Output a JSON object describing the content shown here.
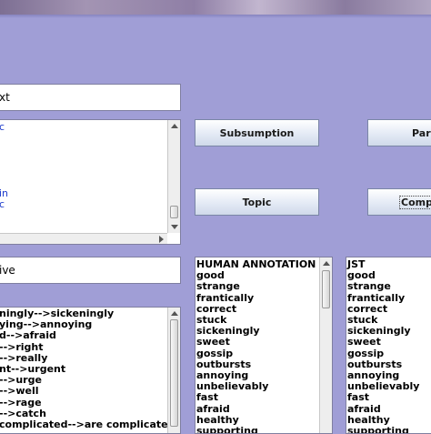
{
  "fields": {
    "top_text": "xt",
    "mid_text": "ive"
  },
  "upper_list": {
    "items": [
      "c",
      "",
      "",
      "",
      "",
      "",
      "in",
      "c"
    ]
  },
  "buttons": {
    "subsumption": "Subsumption",
    "para": "Para",
    "topic": "Topic",
    "compa": "Compa"
  },
  "lower_list": {
    "items": [
      "ningly-->sickeningly",
      "ying-->annoying",
      "d-->afraid",
      "-->right",
      "-->really",
      "nt-->urgent",
      "-->urge",
      "-->well",
      "-->rage",
      "-->catch",
      "complicated-->are complicated"
    ]
  },
  "human_annotation": {
    "header": "HUMAN ANNOTATION",
    "items": [
      "good",
      "strange",
      "frantically",
      "correct",
      "stuck",
      "sickeningly",
      "sweet",
      "gossip",
      "outbursts",
      "annoying",
      "unbelievably",
      "fast",
      "afraid",
      "healthy",
      "supporting"
    ]
  },
  "jst": {
    "header": "JST",
    "items": [
      "good",
      "strange",
      "frantically",
      "correct",
      "stuck",
      "sickeningly",
      "sweet",
      "gossip",
      "outbursts",
      "annoying",
      "unbelievably",
      "fast",
      "afraid",
      "healthy",
      "supporting"
    ]
  }
}
